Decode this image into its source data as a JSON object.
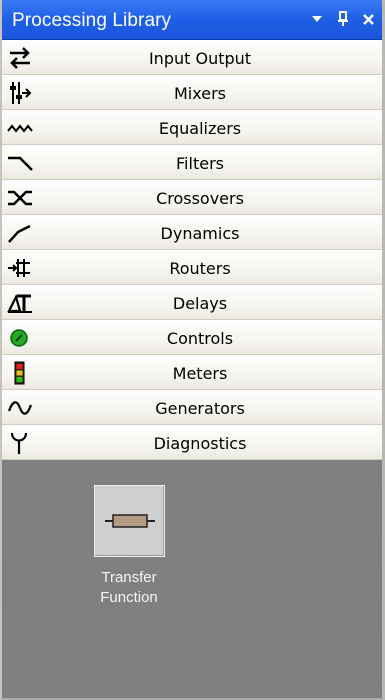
{
  "panel": {
    "title": "Processing Library",
    "buttons": {
      "dropdown_icon": "dropdown-arrow-icon",
      "pin_icon": "pin-icon",
      "close_icon": "close-icon"
    }
  },
  "categories": [
    {
      "label": "Input Output",
      "icon": "input-output-icon"
    },
    {
      "label": "Mixers",
      "icon": "mixers-icon"
    },
    {
      "label": "Equalizers",
      "icon": "equalizers-icon"
    },
    {
      "label": "Filters",
      "icon": "filters-icon"
    },
    {
      "label": "Crossovers",
      "icon": "crossovers-icon"
    },
    {
      "label": "Dynamics",
      "icon": "dynamics-icon"
    },
    {
      "label": "Routers",
      "icon": "routers-icon"
    },
    {
      "label": "Delays",
      "icon": "delays-icon"
    },
    {
      "label": "Controls",
      "icon": "controls-icon"
    },
    {
      "label": "Meters",
      "icon": "meters-icon"
    },
    {
      "label": "Generators",
      "icon": "generators-icon"
    },
    {
      "label": "Diagnostics",
      "icon": "diagnostics-icon"
    }
  ],
  "selected_category": "Diagnostics",
  "items": [
    {
      "label_line1": "Transfer",
      "label_line2": "Function",
      "icon": "transfer-function-icon"
    }
  ],
  "colors": {
    "titlebar": "#1f5fe6",
    "content_bg": "#7e7e7e",
    "tile_bg": "#cfcfcf",
    "tile_glyph": "#b39a80",
    "controls_green": "#22aa22"
  }
}
